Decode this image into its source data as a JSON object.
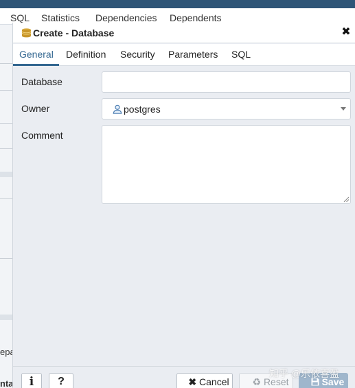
{
  "background": {
    "tabs": [
      "SQL",
      "Statistics",
      "Dependencies",
      "Dependents"
    ],
    "left_fragments": [
      "epa",
      "ntal"
    ]
  },
  "dialog": {
    "title": "Create - Database",
    "tabs": [
      "General",
      "Definition",
      "Security",
      "Parameters",
      "SQL"
    ],
    "active_tab": "General",
    "fields": {
      "database": {
        "label": "Database",
        "value": "",
        "placeholder": ""
      },
      "owner": {
        "label": "Owner",
        "value": "postgres"
      },
      "comment": {
        "label": "Comment",
        "value": ""
      }
    },
    "footer": {
      "info_glyph": "i",
      "help_glyph": "?",
      "cancel_label": "Cancel",
      "reset_label": "Reset",
      "save_label": "Save"
    }
  },
  "watermark": "知乎 @乐依喜盈",
  "colors": {
    "accent": "#326690",
    "header_bar": "#2f5577",
    "save_disabled": "#9fb6cc",
    "dialog_bg": "#eaedf2"
  },
  "icons": {
    "title": "database-icon",
    "close": "close-icon",
    "owner": "user-icon",
    "dropdown": "caret-down-icon",
    "info": "info-icon",
    "help": "help-icon",
    "cancel": "x-icon",
    "reset": "recycle-icon",
    "save": "floppy-disk-icon"
  }
}
